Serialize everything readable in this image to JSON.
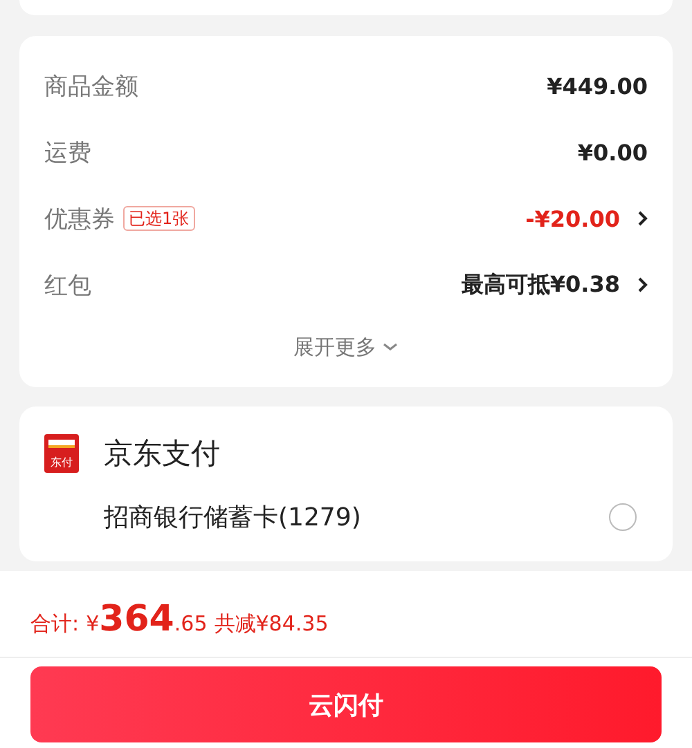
{
  "summary": {
    "rows": [
      {
        "label": "商品金额",
        "value": "¥449.00",
        "highlight": false,
        "arrow": false
      },
      {
        "label": "运费",
        "value": "¥0.00",
        "highlight": false,
        "arrow": false
      },
      {
        "label": "优惠券",
        "tag": "已选1张",
        "value": "-¥20.00",
        "highlight": true,
        "arrow": true
      },
      {
        "label": "红包",
        "value": "最高可抵¥0.38",
        "highlight": false,
        "arrow": true
      }
    ],
    "expand": "展开更多"
  },
  "payment": {
    "logo_text": "东付",
    "title": "京东支付",
    "methods": [
      {
        "name": "招商银行储蓄卡(1279)",
        "selected": false
      }
    ]
  },
  "footer": {
    "total_label": "合计:",
    "currency": "¥",
    "integer": "364",
    "decimal": ".65",
    "saved": "共减¥84.35",
    "pay_button": "云闪付"
  }
}
